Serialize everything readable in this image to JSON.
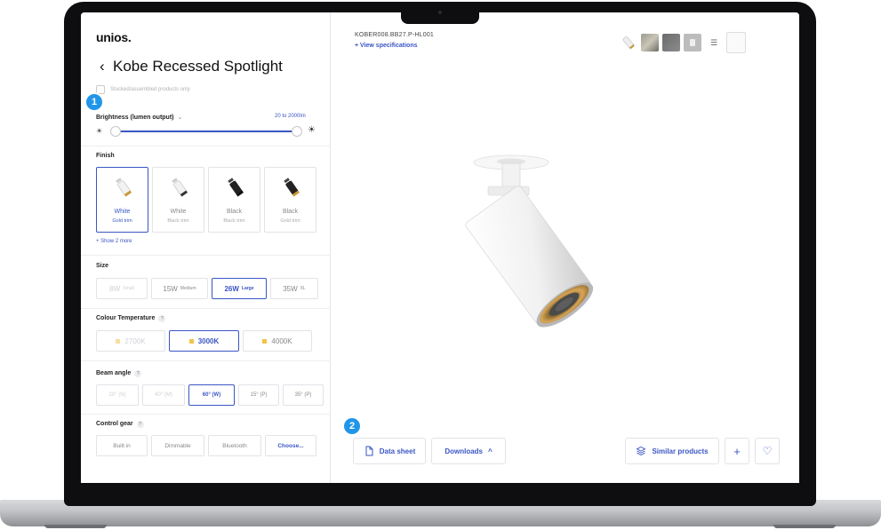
{
  "brand": "unios.",
  "page": {
    "back_glyph": "‹",
    "title": "Kobe Recessed Spotlight",
    "stocked_label": "Stocked/assembled products only"
  },
  "callouts": [
    "1",
    "2"
  ],
  "brightness": {
    "label": "Brightness (lumen output)",
    "chevron": "⌄",
    "range": "20 to 2000lm",
    "low_value": 0,
    "high_value": 1,
    "low_icon": "☀",
    "high_icon": "☀"
  },
  "finish": {
    "label": "Finish",
    "options": [
      {
        "name": "White",
        "sub": "Gold trim",
        "selected": true,
        "body": "#f2f2f2",
        "trim": "#c9963a"
      },
      {
        "name": "White",
        "sub": "Black trim",
        "selected": false,
        "body": "#f2f2f2",
        "trim": "#333333"
      },
      {
        "name": "Black",
        "sub": "Black trim",
        "selected": false,
        "body": "#222222",
        "trim": "#111111"
      },
      {
        "name": "Black",
        "sub": "Gold trim",
        "selected": false,
        "body": "#222222",
        "trim": "#c9963a"
      }
    ],
    "show_more": "+ Show 2 more"
  },
  "size": {
    "label": "Size",
    "options": [
      {
        "value": "8W",
        "sub": "Small",
        "state": "disabled"
      },
      {
        "value": "15W",
        "sub": "Medium",
        "state": "normal"
      },
      {
        "value": "26W",
        "sub": "Large",
        "state": "selected"
      },
      {
        "value": "35W",
        "sub": "XL",
        "state": "normal"
      }
    ]
  },
  "colour_temperature": {
    "label": "Colour Temperature",
    "help": "?",
    "options": [
      {
        "value": "2700K",
        "state": "disabled"
      },
      {
        "value": "3000K",
        "state": "selected"
      },
      {
        "value": "4000K",
        "state": "normal"
      }
    ]
  },
  "beam_angle": {
    "label": "Beam angle",
    "help": "?",
    "options": [
      {
        "value": "20° (N)",
        "state": "disabled"
      },
      {
        "value": "40° (M)",
        "state": "disabled"
      },
      {
        "value": "60° (W)",
        "state": "selected"
      },
      {
        "value": "15° (P)",
        "state": "normal"
      },
      {
        "value": "35° (P)",
        "state": "normal"
      }
    ]
  },
  "control_gear": {
    "label": "Control gear",
    "help": "?",
    "options": [
      {
        "value": "Built in",
        "state": "normal"
      },
      {
        "value": "Dimmable",
        "state": "normal"
      },
      {
        "value": "Bluetooth",
        "state": "normal"
      },
      {
        "value": "Choose...",
        "state": "choose"
      }
    ]
  },
  "right": {
    "sku": "KOBER008.BB27.P-HL001",
    "view_spec": "+ View specifications",
    "list_icon": "☰"
  },
  "actions": {
    "data_sheet": "Data sheet",
    "downloads": "Downloads",
    "downloads_chevron": "^",
    "similar": "Similar products",
    "add": "+",
    "favourite": "♡"
  },
  "colors": {
    "accent": "#3a56c4",
    "callout": "#2196e8",
    "gold": "#c9963a"
  }
}
